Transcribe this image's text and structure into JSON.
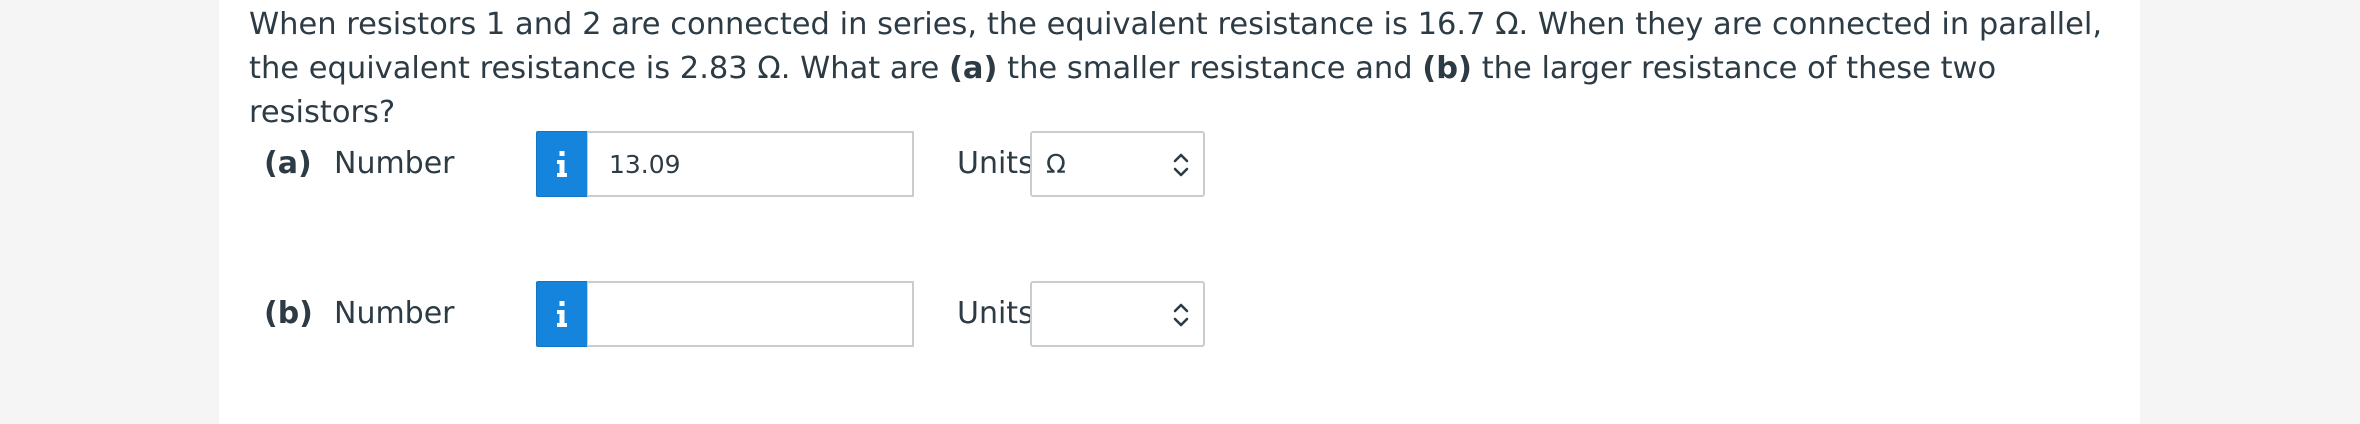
{
  "question": {
    "seg1": "When resistors 1 and 2 are connected in series, the equivalent resistance is 16.7 Ω. When they are connected in parallel, the equivalent resistance is 2.83 Ω. What are ",
    "part_a_marker": "(a)",
    "seg2": " the smaller resistance and ",
    "part_b_marker": "(b)",
    "seg3": " the larger resistance of these two resistors?"
  },
  "answers": [
    {
      "part_label": "(a)",
      "number_label": "Number",
      "info_icon": "info-icon",
      "number_value": "13.09",
      "units_label": "Units",
      "units_value": "Ω",
      "select_icon": "chevron-up-down-icon"
    },
    {
      "part_label": "(b)",
      "number_label": "Number",
      "info_icon": "info-icon",
      "number_value": "",
      "units_label": "Units",
      "units_value": "",
      "select_icon": "chevron-up-down-icon"
    }
  ],
  "colors": {
    "info_button": "#1584dd",
    "text": "#2d3b45",
    "border": "#c7cdd1",
    "background": "#f5f5f5"
  }
}
